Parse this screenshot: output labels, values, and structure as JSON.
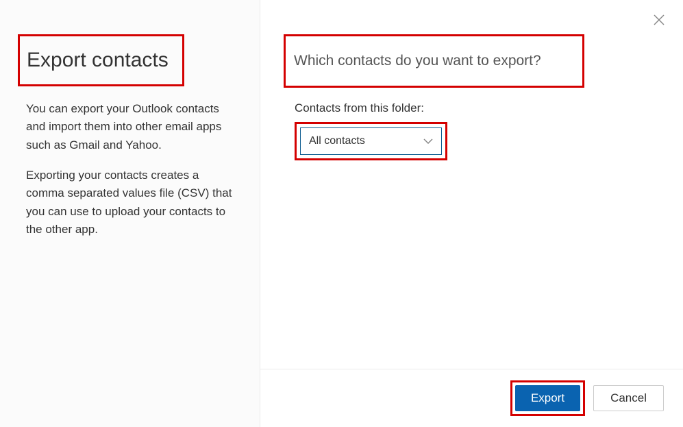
{
  "left": {
    "title": "Export contacts",
    "desc1": "You can export your Outlook contacts and import them into other email apps such as Gmail and Yahoo.",
    "desc2": "Exporting your contacts creates a comma separated values file (CSV) that you can use to upload your contacts to the other app."
  },
  "right": {
    "question": "Which contacts do you want to export?",
    "field_label": "Contacts from this folder:",
    "dropdown_value": "All contacts"
  },
  "footer": {
    "export_label": "Export",
    "cancel_label": "Cancel"
  }
}
